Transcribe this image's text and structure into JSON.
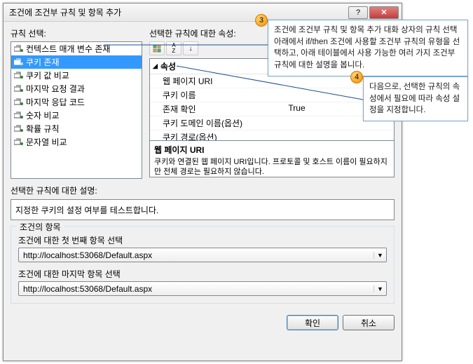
{
  "title": "조건에 조건부 규칙 및 항목 추가",
  "labels": {
    "rule_select": "규칙 선택:",
    "selected_rule_props": "선택한 규칙에 대한 속성:",
    "selected_rule_desc": "선택한 규칙에 대한 설명:",
    "condition_items": "조건의 항목",
    "first_item": "조건에 대한 첫 번째 항목 선택",
    "last_item": "조건에 대한 마지막 항목 선택"
  },
  "rules": [
    {
      "label": "컨텍스트 매개 변수 존재"
    },
    {
      "label": "쿠키 존재"
    },
    {
      "label": "쿠키 값 비교"
    },
    {
      "label": "마지막 요청 결과"
    },
    {
      "label": "마지막 응답 코드"
    },
    {
      "label": "숫자 비교"
    },
    {
      "label": "확률 규칙"
    },
    {
      "label": "문자열 비교"
    }
  ],
  "prop_category": "속성",
  "props": [
    {
      "name": "웹 페이지 URI",
      "value": ""
    },
    {
      "name": "쿠키 이름",
      "value": ""
    },
    {
      "name": "존재 확인",
      "value": "True"
    },
    {
      "name": "쿠키 도메인 이름(옵션)",
      "value": ""
    },
    {
      "name": "쿠키 경로(옵션)",
      "value": ""
    }
  ],
  "propdesc": {
    "title": "웹 페이지 URI",
    "body": "쿠키와 연결된 웹 페이지 URI입니다. 프로토콜 및 호스트 이름이 필요하지만 전체 경로는 필요하지 않습니다."
  },
  "rule_desc": "지정한 쿠키의 설정 여부를 테스트합니다.",
  "combo1_value": "http://localhost:53068/Default.aspx",
  "combo2_value": "http://localhost:53068/Default.aspx",
  "buttons": {
    "ok": "확인",
    "cancel": "취소"
  },
  "callouts": {
    "c3_num": "3",
    "c3": "조건에 조건부 규칙 및 항목 추가 대화 상자의 규칙 선택 아래에서 if/then 조건에 사용할 조건부 규칙의 유형을 선택하고, 아래 테이블에서 사용 가능한 여러 가지 조건부 규칙에 대한 설명을 봅니다.",
    "c4_num": "4",
    "c4": "다음으로, 선택한 규칙의 속성에서 필요에 따라 속성 설정을 지정합니다."
  }
}
